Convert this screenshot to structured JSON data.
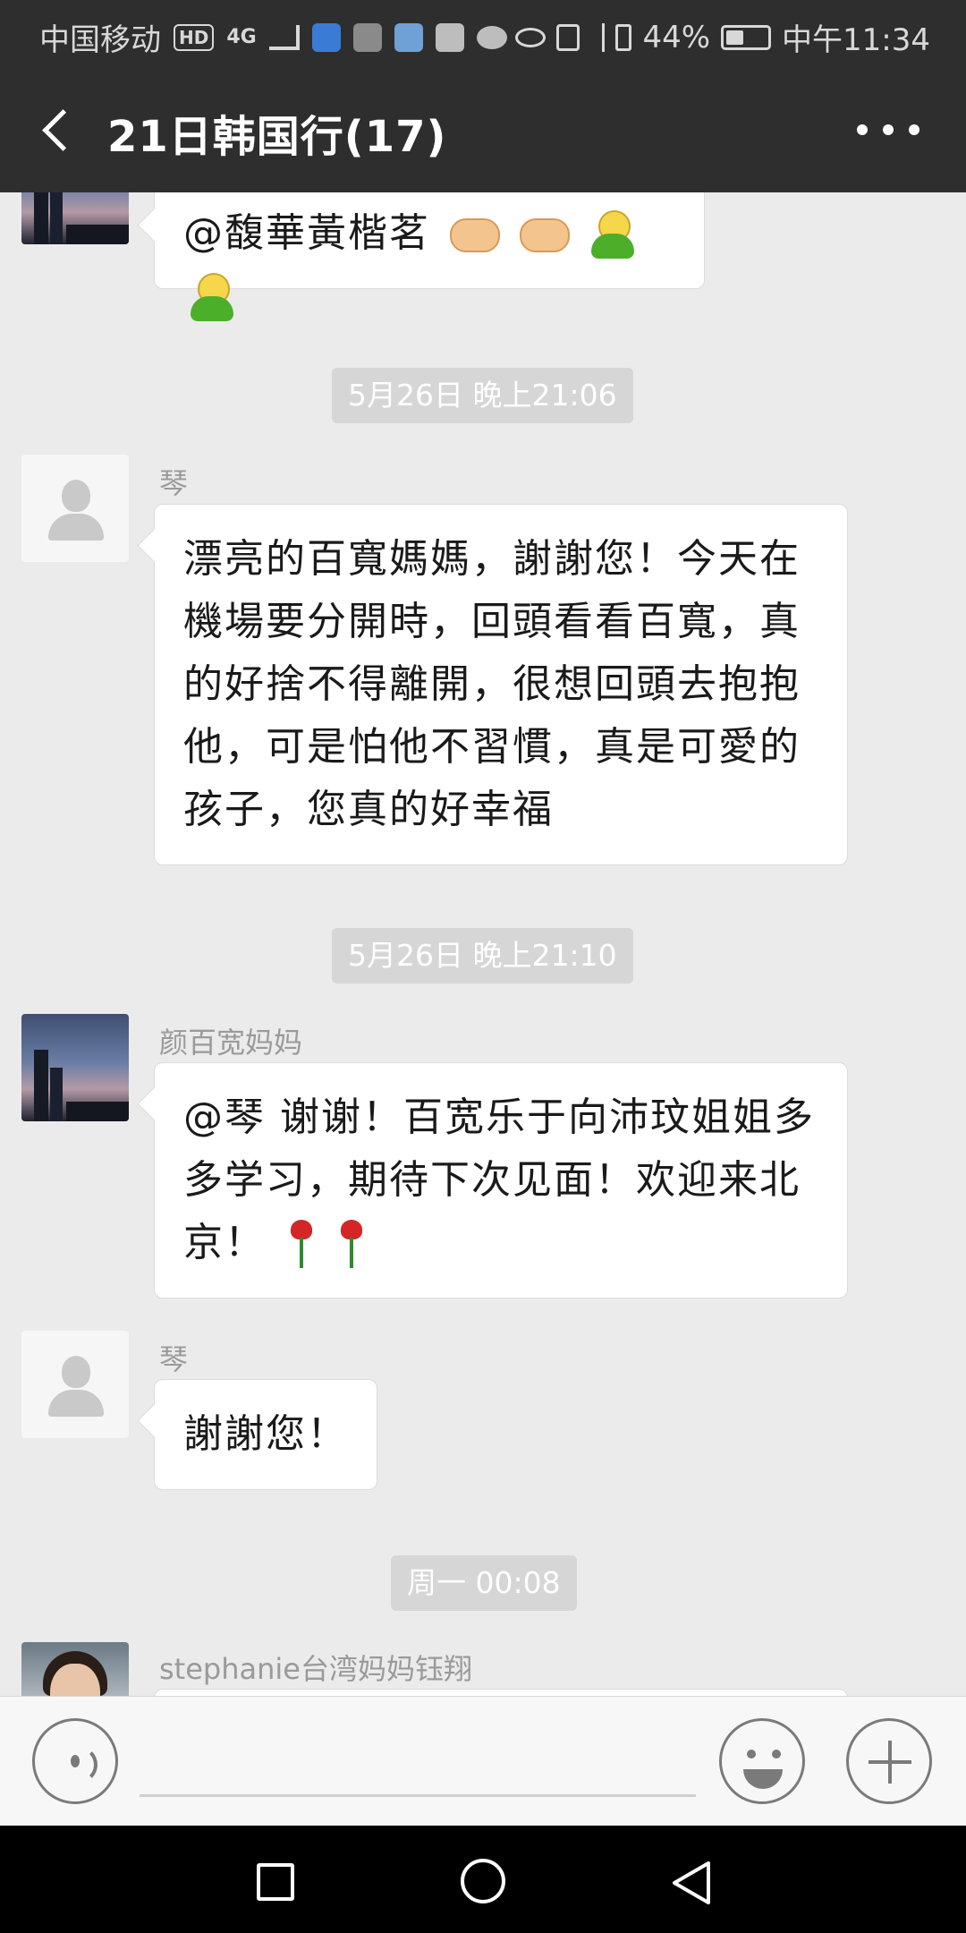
{
  "status_bar": {
    "carrier": "中国移动",
    "hd": "HD",
    "network": "4G",
    "battery_percent": "44%",
    "battery_level": 0.44,
    "time": "中午11:34",
    "icons": [
      "signal-icon",
      "shield-icon",
      "app-icon",
      "browser-icon",
      "info-icon",
      "message-icon",
      "eye-icon",
      "nfc-icon",
      "bluetooth-icon",
      "vibrate-icon",
      "battery-icon"
    ]
  },
  "header": {
    "title": "21日韩国行(17)",
    "back_icon": "back-arrow-icon",
    "more_icon": "more-icon"
  },
  "messages": [
    {
      "type": "message",
      "avatar": "city",
      "text": "@馥華黃楷茗",
      "emojis": [
        "handshake",
        "handshake",
        "green-blob",
        "green-blob"
      ]
    },
    {
      "type": "time",
      "text": "5月26日 晚上21:06"
    },
    {
      "type": "message",
      "avatar": "default",
      "sender": "琴",
      "text": "漂亮的百寬媽媽，謝謝您！今天在機場要分開時，回頭看看百寬，真的好捨不得離開，很想回頭去抱抱他，可是怕他不習慣，真是可愛的孩子，您真的好幸福"
    },
    {
      "type": "time",
      "text": "5月26日 晚上21:10"
    },
    {
      "type": "message",
      "avatar": "city",
      "sender": "颜百宽妈妈",
      "text": "@琴  谢谢！百宽乐于向沛玟姐姐多多学习，期待下次见面！欢迎来北京！",
      "emojis": [
        "rose",
        "rose"
      ]
    },
    {
      "type": "message",
      "avatar": "default",
      "sender": "琴",
      "text": "謝謝您！"
    },
    {
      "type": "time",
      "text": "周一 00:08"
    },
    {
      "type": "message",
      "avatar": "person",
      "sender": "stephanie台湾妈妈钰翔",
      "text": ""
    }
  ],
  "input_bar": {
    "voice_icon": "voice-icon",
    "emoji_icon": "emoji-icon",
    "plus_icon": "plus-icon",
    "text_value": ""
  },
  "nav_bar": {
    "icons": [
      "recent-apps-icon",
      "home-icon",
      "nav-back-icon"
    ]
  }
}
